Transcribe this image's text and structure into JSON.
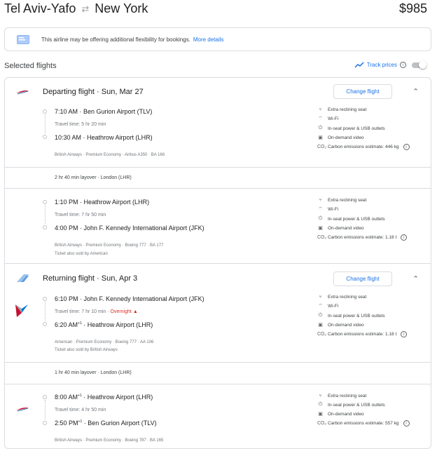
{
  "header": {
    "origin": "Tel Aviv-Yafo",
    "destination": "New York",
    "price": "$985"
  },
  "notice": {
    "text": "This airline may be offering additional flexibility for bookings.",
    "link": "More details"
  },
  "selected_label": "Selected flights",
  "track": {
    "label": "Track prices",
    "enabled": false
  },
  "change_label": "Change flight",
  "departing": {
    "title": "Departing flight",
    "date": "Sun, Mar 27",
    "segments": [
      {
        "dep_time": "7:10 AM",
        "dep_airport": "Ben Gurion Airport (TLV)",
        "travel_time": "Travel time: 5 hr 20 min",
        "arr_time": "10:30 AM",
        "arr_airport": "Heathrow Airport (LHR)",
        "meta": "British Airways · Premium Economy · Airbus A350 · BA 166",
        "amenities": [
          "Extra reclining seat",
          "Wi-Fi",
          "In-seat power & USB outlets",
          "On-demand video",
          "Carbon emissions estimate: 446 kg"
        ]
      },
      {
        "dep_time": "1:10 PM",
        "dep_airport": "Heathrow Airport (LHR)",
        "travel_time": "Travel time: 7 hr 50 min",
        "arr_time": "4:00 PM",
        "arr_airport": "John F. Kennedy International Airport (JFK)",
        "meta": "British Airways · Premium Economy · Boeing 777 · BA 177",
        "meta2": "Ticket also sold by American",
        "amenities": [
          "Extra reclining seat",
          "Wi-Fi",
          "In-seat power & USB outlets",
          "On-demand video",
          "Carbon emissions estimate: 1.18 t"
        ]
      }
    ],
    "layover": "2 hr 40 min layover · London (LHR)"
  },
  "returning": {
    "title": "Returning flight",
    "date": "Sun, Apr 3",
    "segments": [
      {
        "dep_time": "6:10 PM",
        "dep_airport": "John F. Kennedy International Airport (JFK)",
        "travel_time": "Travel time: 7 hr 10 min",
        "overnight": "Overnight",
        "arr_time": "6:20 AM",
        "arr_sup": "+1",
        "arr_airport": "Heathrow Airport (LHR)",
        "meta": "American · Premium Economy · Boeing 777 · AA 106",
        "meta2": "Ticket also sold by British Airways",
        "amenities": [
          "Extra reclining seat",
          "Wi-Fi",
          "In-seat power & USB outlets",
          "On-demand video",
          "Carbon emissions estimate: 1.18 t"
        ]
      },
      {
        "dep_time": "8:00 AM",
        "dep_sup": "+1",
        "dep_airport": "Heathrow Airport (LHR)",
        "travel_time": "Travel time: 4 hr 50 min",
        "arr_time": "2:50 PM",
        "arr_sup": "+1",
        "arr_airport": "Ben Gurion Airport (TLV)",
        "meta": "British Airways · Premium Economy · Boeing 787 · BA 165",
        "amenities": [
          "Extra reclining seat",
          "In-seat power & USB outlets",
          "On-demand video",
          "Carbon emissions estimate: 557 kg"
        ]
      }
    ],
    "layover": "1 hr 40 min layover · London (LHR)"
  },
  "colors": {
    "link": "#1a73e8",
    "warning": "#d93025",
    "border": "#dadce0",
    "ba_red": "#c4122f",
    "aa_blue": "#0078d2"
  }
}
